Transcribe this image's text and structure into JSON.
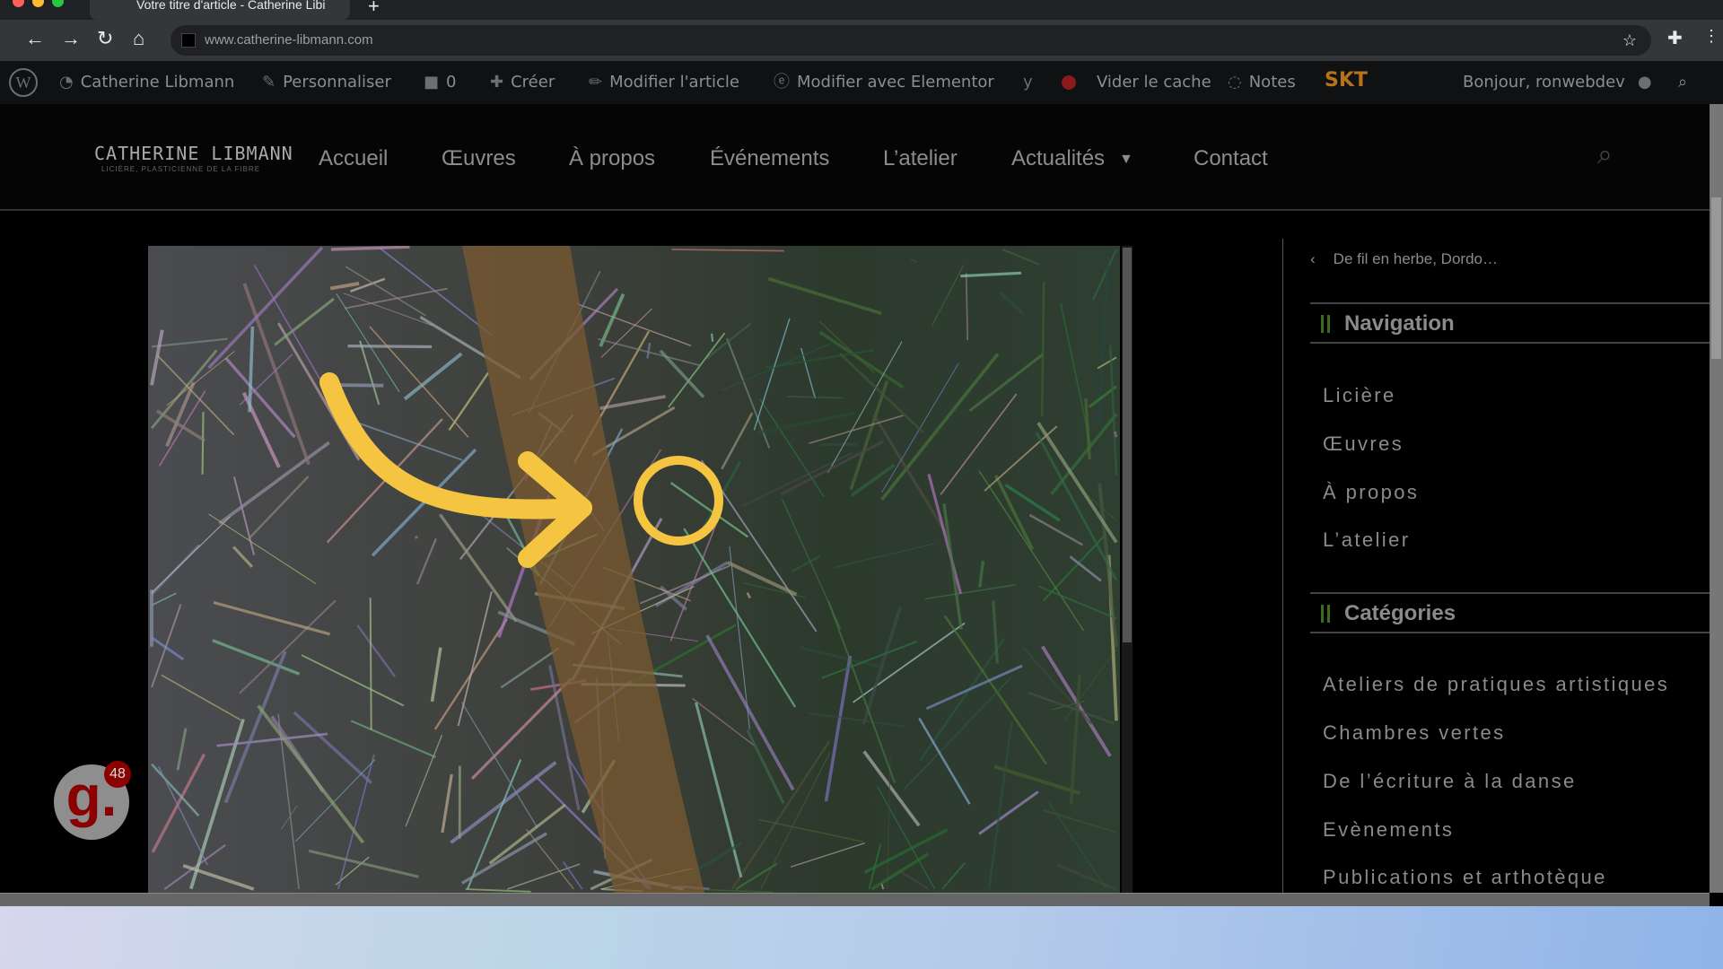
{
  "browser": {
    "tab_title": "Votre titre d'article - Catherine Libi",
    "url": "www.catherine-libmann.com",
    "icons": [
      "back-icon",
      "forward-icon",
      "reload-icon",
      "home-icon",
      "star-icon",
      "extensions-icon",
      "menu-icon"
    ]
  },
  "wpbar": {
    "site": "Catherine Libmann",
    "customize": "Personnaliser",
    "comments": "0",
    "create": "Créer",
    "edit_post": "Modifier l'article",
    "elementor": "Modifier avec Elementor",
    "cache": "Vider le cache",
    "notes": "Notes",
    "skt": "SKT",
    "greeting": "Bonjour, ronwebdev"
  },
  "site": {
    "logo_title": "CATHERINE LIBMANN",
    "logo_subtitle": "LICIÈRE, PLASTICIENNE DE LA FIBRE",
    "nav": [
      "Accueil",
      "Œuvres",
      "À propos",
      "Événements",
      "L’atelier",
      "Actualités",
      "Contact"
    ]
  },
  "sidebar": {
    "prev_post": "De fil en herbe, Dordo…",
    "navigation_title": "Navigation",
    "navigation_items": [
      "Licière",
      "Œuvres",
      "À propos",
      "L’atelier"
    ],
    "categories_title": "Catégories",
    "categories_items": [
      "Ateliers de pratiques artistiques",
      "Chambres vertes",
      "De l’écriture à la danse",
      "Evènements",
      "Publications et arthotèque"
    ]
  },
  "widget": {
    "letter": "g.",
    "count": "48"
  },
  "colors": {
    "accent_yellow": "#f5c542",
    "wp_bar": "#0f1113",
    "heading_bar": "#3a6b1e",
    "badge_red": "#8b0000"
  }
}
